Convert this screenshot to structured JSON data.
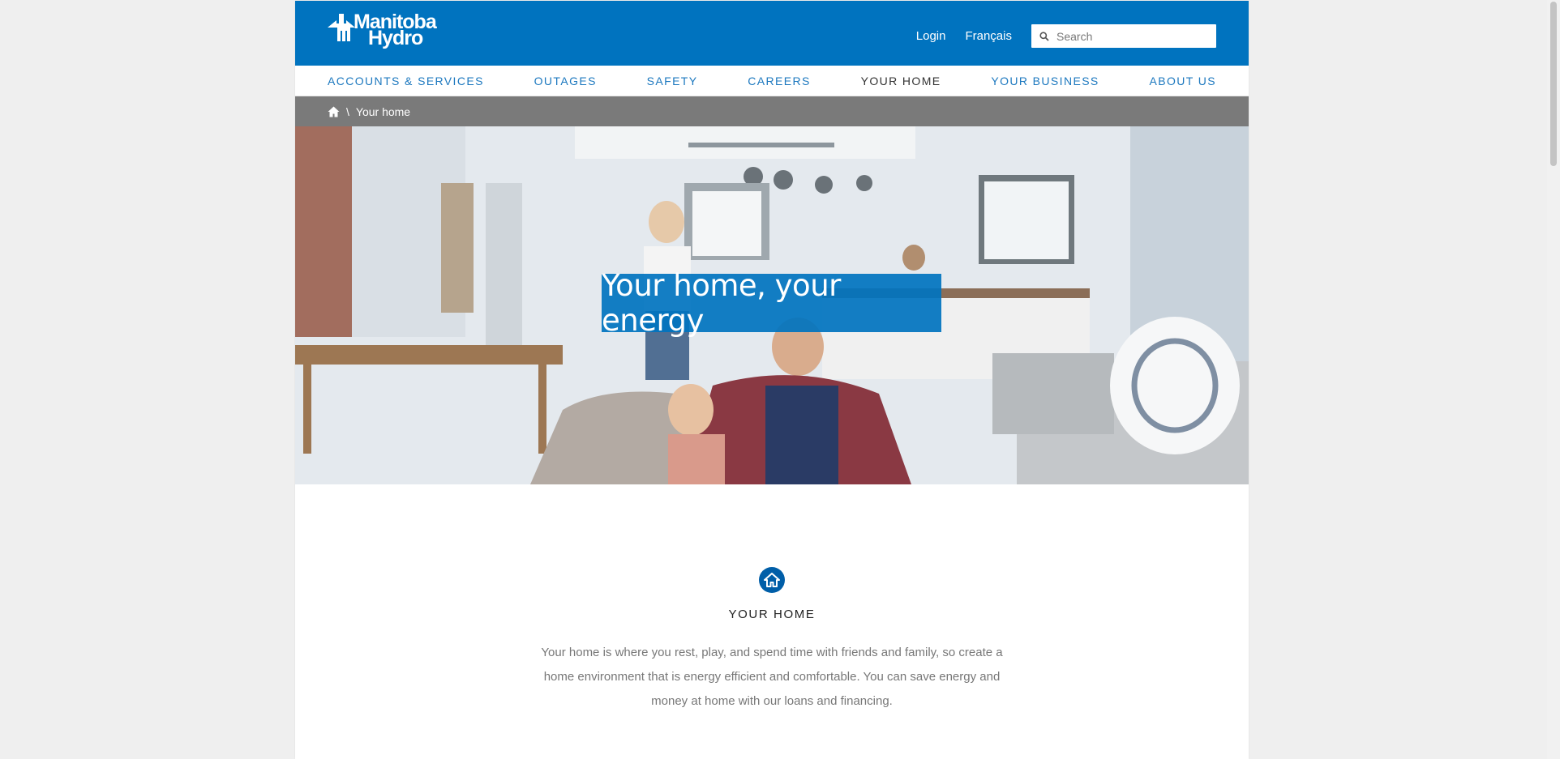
{
  "brand": {
    "line1": "Manitoba",
    "line2": "Hydro"
  },
  "header": {
    "login": "Login",
    "french": "Français",
    "search_placeholder": "Search"
  },
  "nav": {
    "items": [
      "ACCOUNTS & SERVICES",
      "OUTAGES",
      "SAFETY",
      "CAREERS",
      "YOUR HOME",
      "YOUR BUSINESS",
      "ABOUT US"
    ],
    "active": "YOUR HOME"
  },
  "breadcrumb": {
    "separator": "\\",
    "current": "Your home"
  },
  "hero": {
    "title": "Your home, your energy"
  },
  "intro": {
    "heading": "YOUR HOME",
    "text": "Your home is where you rest, play, and spend time with friends and family, so create a home environment that is energy efficient and comfortable. You can save energy and money at home with our loans and financing."
  },
  "colors": {
    "brand_blue": "#0073bf",
    "nav_link": "#1c78bf",
    "breadcrumb_bg": "#7a7a7a",
    "icon_circle": "#005ea8"
  },
  "icons": [
    "manitoba-hydro-logo",
    "search-icon",
    "home-icon",
    "home-circle-icon"
  ]
}
